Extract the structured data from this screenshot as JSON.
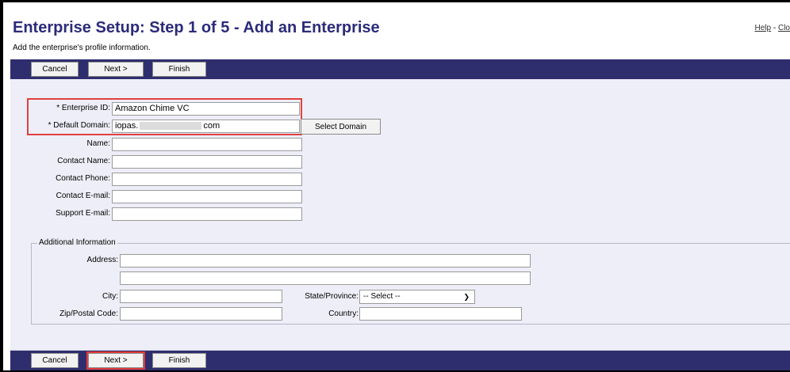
{
  "header": {
    "title": "Enterprise Setup: Step 1 of 5 - Add an Enterprise",
    "subtitle": "Add the enterprise's profile information.",
    "help_link": "Help",
    "separator": " - ",
    "close_link": "Clo"
  },
  "toolbar": {
    "cancel": "Cancel",
    "next": "Next >",
    "finish": "Finish"
  },
  "form": {
    "enterprise_id": {
      "label": "* Enterprise ID:",
      "value": "Amazon Chime VC"
    },
    "default_domain": {
      "label": "* Default Domain:",
      "value_prefix": "iopas.",
      "value_suffix": "com"
    },
    "select_domain_button": "Select Domain",
    "name": {
      "label": "Name:",
      "value": ""
    },
    "contact_name": {
      "label": "Contact Name:",
      "value": ""
    },
    "contact_phone": {
      "label": "Contact Phone:",
      "value": ""
    },
    "contact_email": {
      "label": "Contact E-mail:",
      "value": ""
    },
    "support_email": {
      "label": "Support E-mail:",
      "value": ""
    }
  },
  "additional": {
    "legend": "Additional Information",
    "address": {
      "label": "Address:",
      "line1": "",
      "line2": ""
    },
    "city": {
      "label": "City:",
      "value": ""
    },
    "state": {
      "label": "State/Province:",
      "selected": "-- Select --"
    },
    "zip": {
      "label": "Zip/Postal Code:",
      "value": ""
    },
    "country": {
      "label": "Country:",
      "value": ""
    }
  },
  "colors": {
    "toolbar_bg": "#2e2e6e",
    "title": "#2b2b7a",
    "panel_bg": "#eeeef8",
    "highlight": "#e04040"
  }
}
